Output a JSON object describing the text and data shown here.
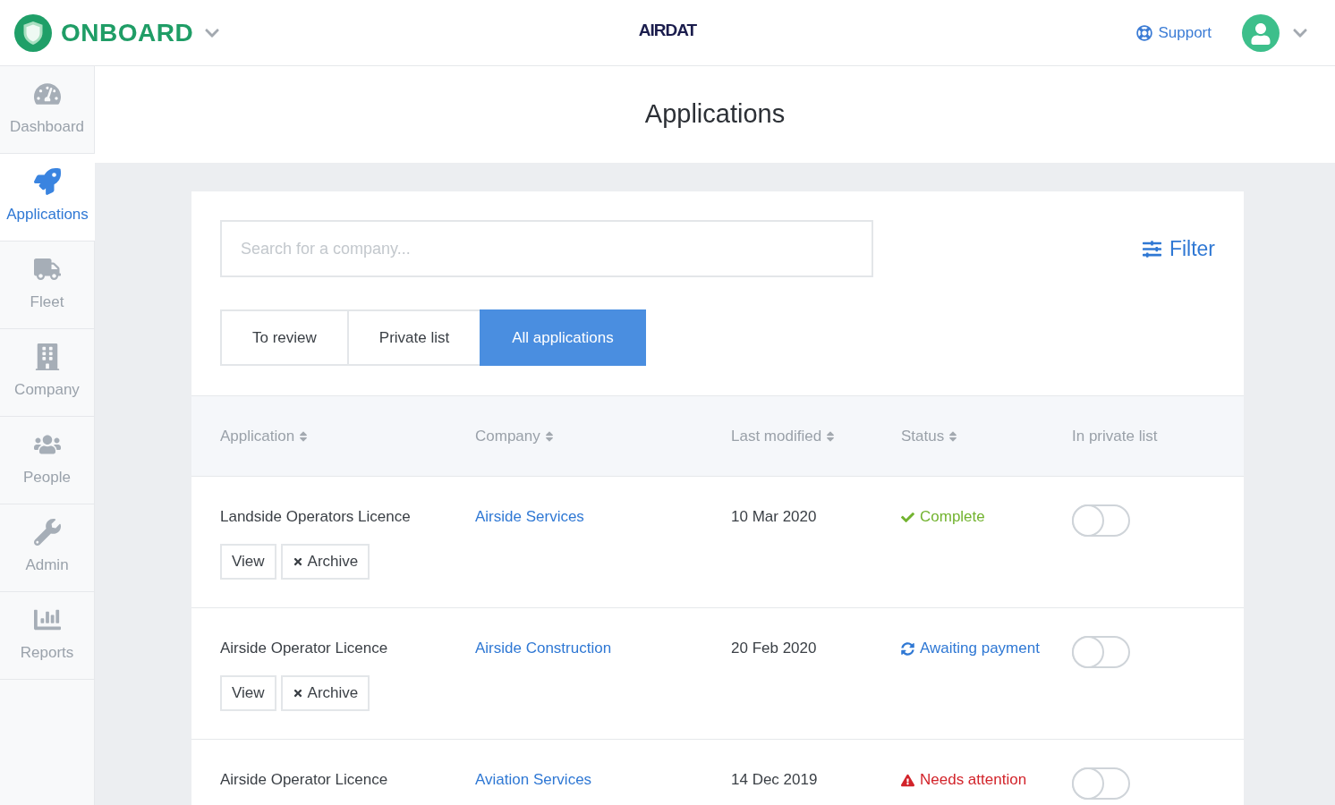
{
  "header": {
    "brand": "ONBOARD",
    "logo": "AIRDAT",
    "support": "Support"
  },
  "sidebar": {
    "items": [
      {
        "kind": "dashboard",
        "label": "Dashboard",
        "selected": false
      },
      {
        "kind": "applications",
        "label": "Applications",
        "selected": true
      },
      {
        "kind": "fleet",
        "label": "Fleet",
        "selected": false
      },
      {
        "kind": "company",
        "label": "Company",
        "selected": false
      },
      {
        "kind": "people",
        "label": "People",
        "selected": false
      },
      {
        "kind": "admin",
        "label": "Admin",
        "selected": false
      },
      {
        "kind": "reports",
        "label": "Reports",
        "selected": false
      }
    ]
  },
  "page": {
    "title": "Applications"
  },
  "search": {
    "placeholder": "Search for a company..."
  },
  "filter": {
    "label": "Filter"
  },
  "tabs": [
    {
      "label": "To review",
      "selected": false
    },
    {
      "label": "Private list",
      "selected": false
    },
    {
      "label": "All applications",
      "selected": true
    }
  ],
  "table": {
    "columns": [
      {
        "label": "Application",
        "sortable": true
      },
      {
        "label": "Company",
        "sortable": true
      },
      {
        "label": "Last modified",
        "sortable": true
      },
      {
        "label": "Status",
        "sortable": true
      },
      {
        "label": "In private list",
        "sortable": false
      }
    ],
    "rows": [
      {
        "application": "Landside Operators Licence",
        "company": "Airside Services",
        "last_modified": "10 Mar 2020",
        "status": {
          "kind": "complete",
          "label": "Complete"
        },
        "in_private_list": false,
        "actions": [
          {
            "kind": "view",
            "label": "View"
          },
          {
            "kind": "archive",
            "label": "Archive"
          }
        ]
      },
      {
        "application": "Airside Operator Licence",
        "company": "Airside Construction",
        "last_modified": "20 Feb 2020",
        "status": {
          "kind": "pending",
          "label": "Awaiting payment"
        },
        "in_private_list": false,
        "actions": [
          {
            "kind": "view",
            "label": "View"
          },
          {
            "kind": "archive",
            "label": "Archive"
          }
        ]
      },
      {
        "application": "Airside Operator Licence",
        "company": "Aviation Services",
        "last_modified": "14 Dec 2019",
        "status": {
          "kind": "attention",
          "label": "Needs attention"
        },
        "in_private_list": false
      }
    ]
  }
}
